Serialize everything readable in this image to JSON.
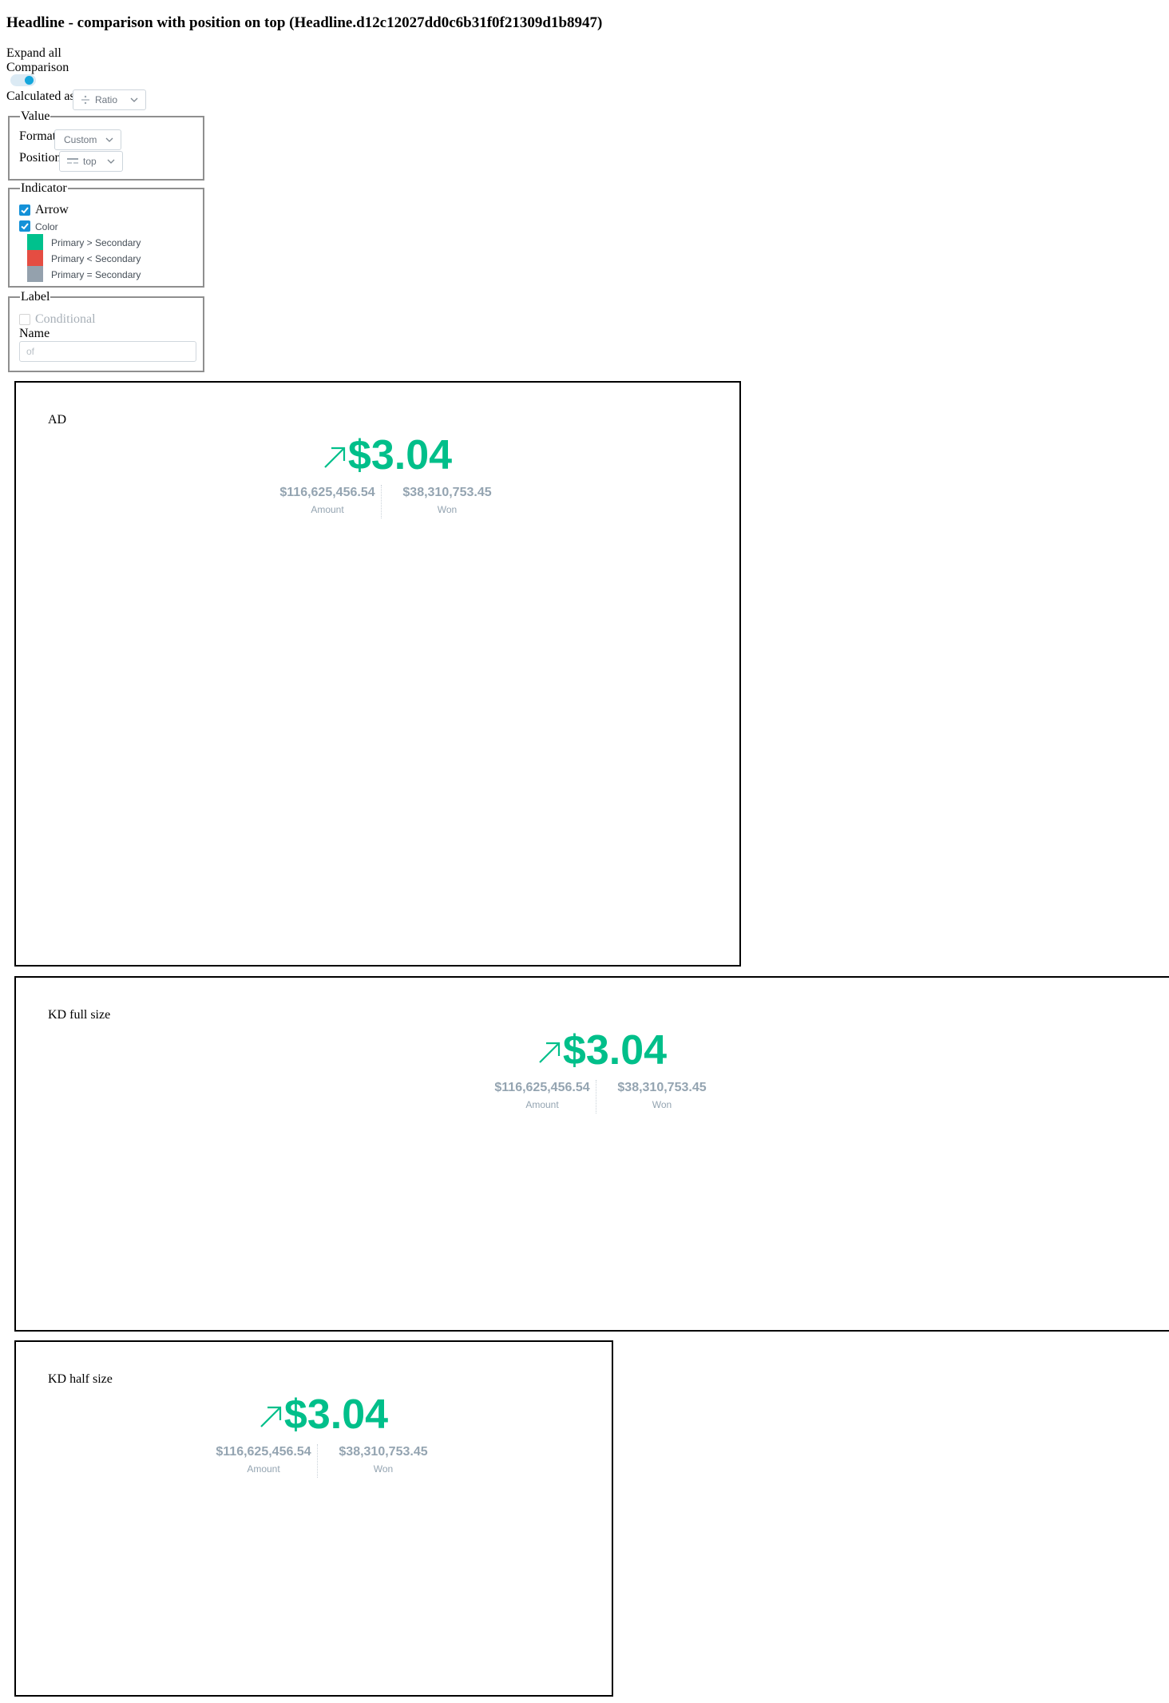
{
  "page": {
    "title": "Headline - comparison with position on top (Headline.d12c12027dd0c6b31f0f21309d1b8947)",
    "expand_all": "Expand all",
    "comparison_label": "Comparison",
    "comparison_enabled": true,
    "calculated_as_label": "Calculated as",
    "calculated_as_value": "Ratio"
  },
  "value_group": {
    "legend": "Value",
    "format_label": "Format",
    "format_value": "Custom",
    "position_label": "Position",
    "position_value": "top"
  },
  "indicator_group": {
    "legend": "Indicator",
    "arrow_label": "Arrow",
    "arrow_checked": true,
    "color_label": "Color",
    "color_checked": true,
    "colors": [
      {
        "label": "Primary > Secondary",
        "color": "#00c18d"
      },
      {
        "label": "Primary < Secondary",
        "color": "#e54d42"
      },
      {
        "label": "Primary = Secondary",
        "color": "#94a1ad"
      }
    ]
  },
  "label_group": {
    "legend": "Label",
    "conditional_label": "Conditional",
    "conditional_checked": false,
    "name_label": "Name",
    "name_placeholder": "of"
  },
  "panels": [
    {
      "title": "AD",
      "primary_value": "$3.04",
      "secondary_1_value": "$116,625,456.54",
      "secondary_1_label": "Amount",
      "secondary_2_value": "$38,310,753.45",
      "secondary_2_label": "Won"
    },
    {
      "title": "KD full size",
      "primary_value": "$3.04",
      "secondary_1_value": "$116,625,456.54",
      "secondary_1_label": "Amount",
      "secondary_2_value": "$38,310,753.45",
      "secondary_2_label": "Won"
    },
    {
      "title": "KD half size",
      "primary_value": "$3.04",
      "secondary_1_value": "$116,625,456.54",
      "secondary_1_label": "Amount",
      "secondary_2_value": "$38,310,753.45",
      "secondary_2_label": "Won"
    }
  ],
  "colors": {
    "positive": "#00bf8a",
    "secondary_text": "#94a4b1",
    "toggle_accent": "#14a6dc"
  }
}
